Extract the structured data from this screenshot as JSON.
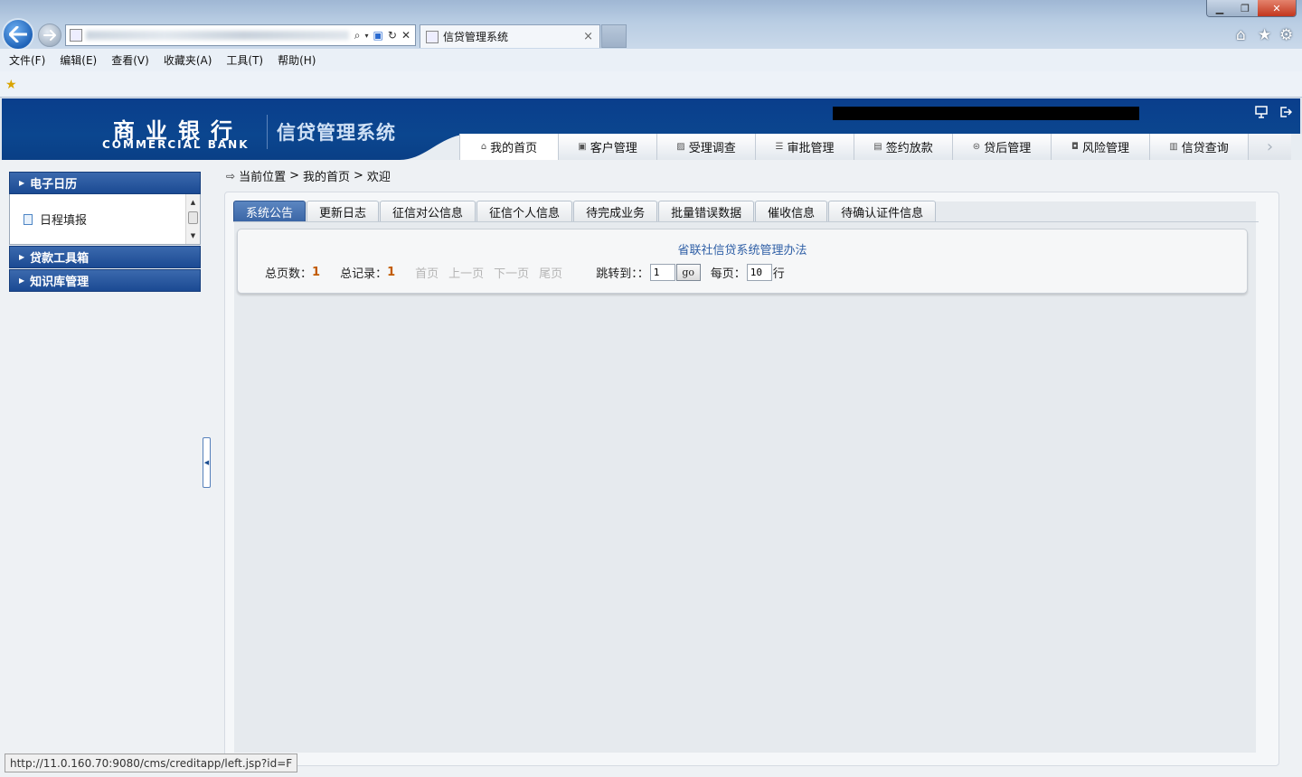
{
  "browser": {
    "tab_title": "信贷管理系统",
    "tab_close": "×",
    "menu": [
      "文件(F)",
      "编辑(E)",
      "查看(V)",
      "收藏夹(A)",
      "工具(T)",
      "帮助(H)"
    ],
    "status_url": "http://11.0.160.70:9080/cms/creditapp/left.jsp?id=F",
    "icons": [
      "back-arrow-icon",
      "forward-arrow-icon",
      "search-icon",
      "refresh-icon",
      "stop-icon",
      "home-icon",
      "favorites-star-icon",
      "gear-icon"
    ]
  },
  "header": {
    "logo_cn": "商业银行",
    "logo_en": "COMMERCIAL BANK",
    "system_title": "信贷管理系统",
    "nav": [
      {
        "label": "我的首页",
        "icon": "home-icon"
      },
      {
        "label": "客户管理",
        "icon": "card-icon"
      },
      {
        "label": "受理调查",
        "icon": "image-icon"
      },
      {
        "label": "审批管理",
        "icon": "list-icon"
      },
      {
        "label": "签约放款",
        "icon": "document-icon"
      },
      {
        "label": "贷后管理",
        "icon": "coin-icon"
      },
      {
        "label": "风险管理",
        "icon": "alert-icon"
      },
      {
        "label": "信贷查询",
        "icon": "report-icon"
      }
    ],
    "nav_more": "›"
  },
  "sidebar": {
    "sections": [
      {
        "label": "电子日历",
        "items": [
          {
            "label": "日程填报"
          }
        ]
      },
      {
        "label": "贷款工具箱"
      },
      {
        "label": "知识库管理"
      }
    ]
  },
  "breadcrumb": {
    "prefix": "当前位置",
    "sep": ">",
    "items": [
      "我的首页",
      "欢迎"
    ]
  },
  "tabs": [
    "系统公告",
    "更新日志",
    "征信对公信息",
    "征信个人信息",
    "待完成业务",
    "批量错误数据",
    "催收信息",
    "待确认证件信息"
  ],
  "notice": {
    "title": "省联社信贷系统管理办法"
  },
  "pager": {
    "total_pages_label": "总页数：",
    "total_pages": "1",
    "total_records_label": "总记录：",
    "total_records": "1",
    "first": "首页",
    "prev": "上一页",
    "next": "下一页",
    "last": "尾页",
    "jump_label": "跳转到：：",
    "jump_value": "1",
    "go": "go",
    "per_page_label": "每页：",
    "per_page_value": "10",
    "rows_suffix": "行"
  },
  "colors": {
    "header_blue": "#0b468f",
    "accent_orange": "#c25a00",
    "link_blue": "#2f5fa6"
  }
}
